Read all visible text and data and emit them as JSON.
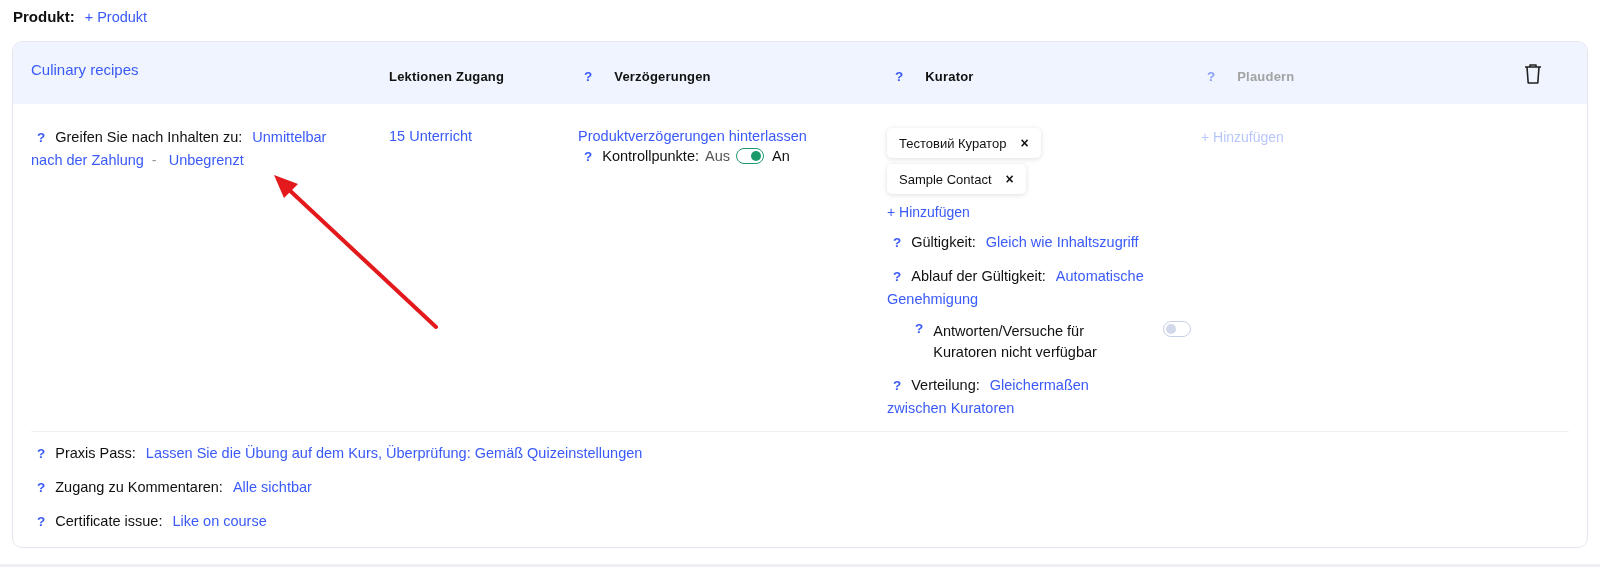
{
  "product": {
    "label": "Produkt:",
    "add": "+ Produkt"
  },
  "card": {
    "title": "Culinary recipes",
    "columns": [
      {
        "label": "Lektionen Zugang",
        "disabled": false
      },
      {
        "help": "?",
        "label": "Verzögerungen",
        "disabled": false
      },
      {
        "help": "?",
        "label": "Kurator",
        "disabled": false
      },
      {
        "help": "?",
        "label": "Plaudern",
        "disabled": true
      }
    ],
    "access": {
      "help": "?",
      "label": "Greifen Sie nach Inhalten zu:",
      "value_1": [
        "Unmittelbar",
        "nach der Zahlung"
      ],
      "separator": "-",
      "value_2": "Unbegrenzt"
    },
    "lessons": "15 Unterricht",
    "delays": {
      "link": "Produktverzögerungen hinterlassen",
      "checkpoints": {
        "help": "?",
        "label": "Kontrollpunkte:",
        "off_label": "Aus",
        "on_label": "An",
        "on": true
      }
    },
    "curators": {
      "tags": [
        {
          "name": "Тестовий Куратор",
          "remove": "×"
        },
        {
          "name": "Sample Contact",
          "remove": "×"
        }
      ],
      "add": "+ Hinzufügen",
      "settings": [
        {
          "kind": "link",
          "help": "?",
          "label": "Gültigkeit:",
          "value": [
            "Gleich wie Inhaltszugriff"
          ]
        },
        {
          "kind": "link",
          "help": "?",
          "label": "Ablauf der Gültigkeit:",
          "value": [
            "Automatische",
            "Genehmigung"
          ]
        },
        {
          "kind": "toggle",
          "help": "?",
          "label": "Antworten/Versuche für Kuratoren nicht verfügbar",
          "on": false
        },
        {
          "kind": "link",
          "help": "?",
          "label": "Verteilung:",
          "value": [
            "Gleichermaßen",
            "zwischen Kuratoren"
          ]
        }
      ]
    },
    "chat": {
      "add": "+ Hinzufügen",
      "disabled": true
    },
    "footer": [
      {
        "help": "?",
        "label": "Praxis Pass:",
        "value": "Lassen Sie die Übung auf dem Kurs, Überprüfung: Gemäß Quizeinstellungen"
      },
      {
        "help": "?",
        "label": "Zugang zu Kommentaren:",
        "value": "Alle sichtbar"
      },
      {
        "help": "?",
        "label": "Certificate issue:",
        "value": "Like on course"
      }
    ]
  }
}
